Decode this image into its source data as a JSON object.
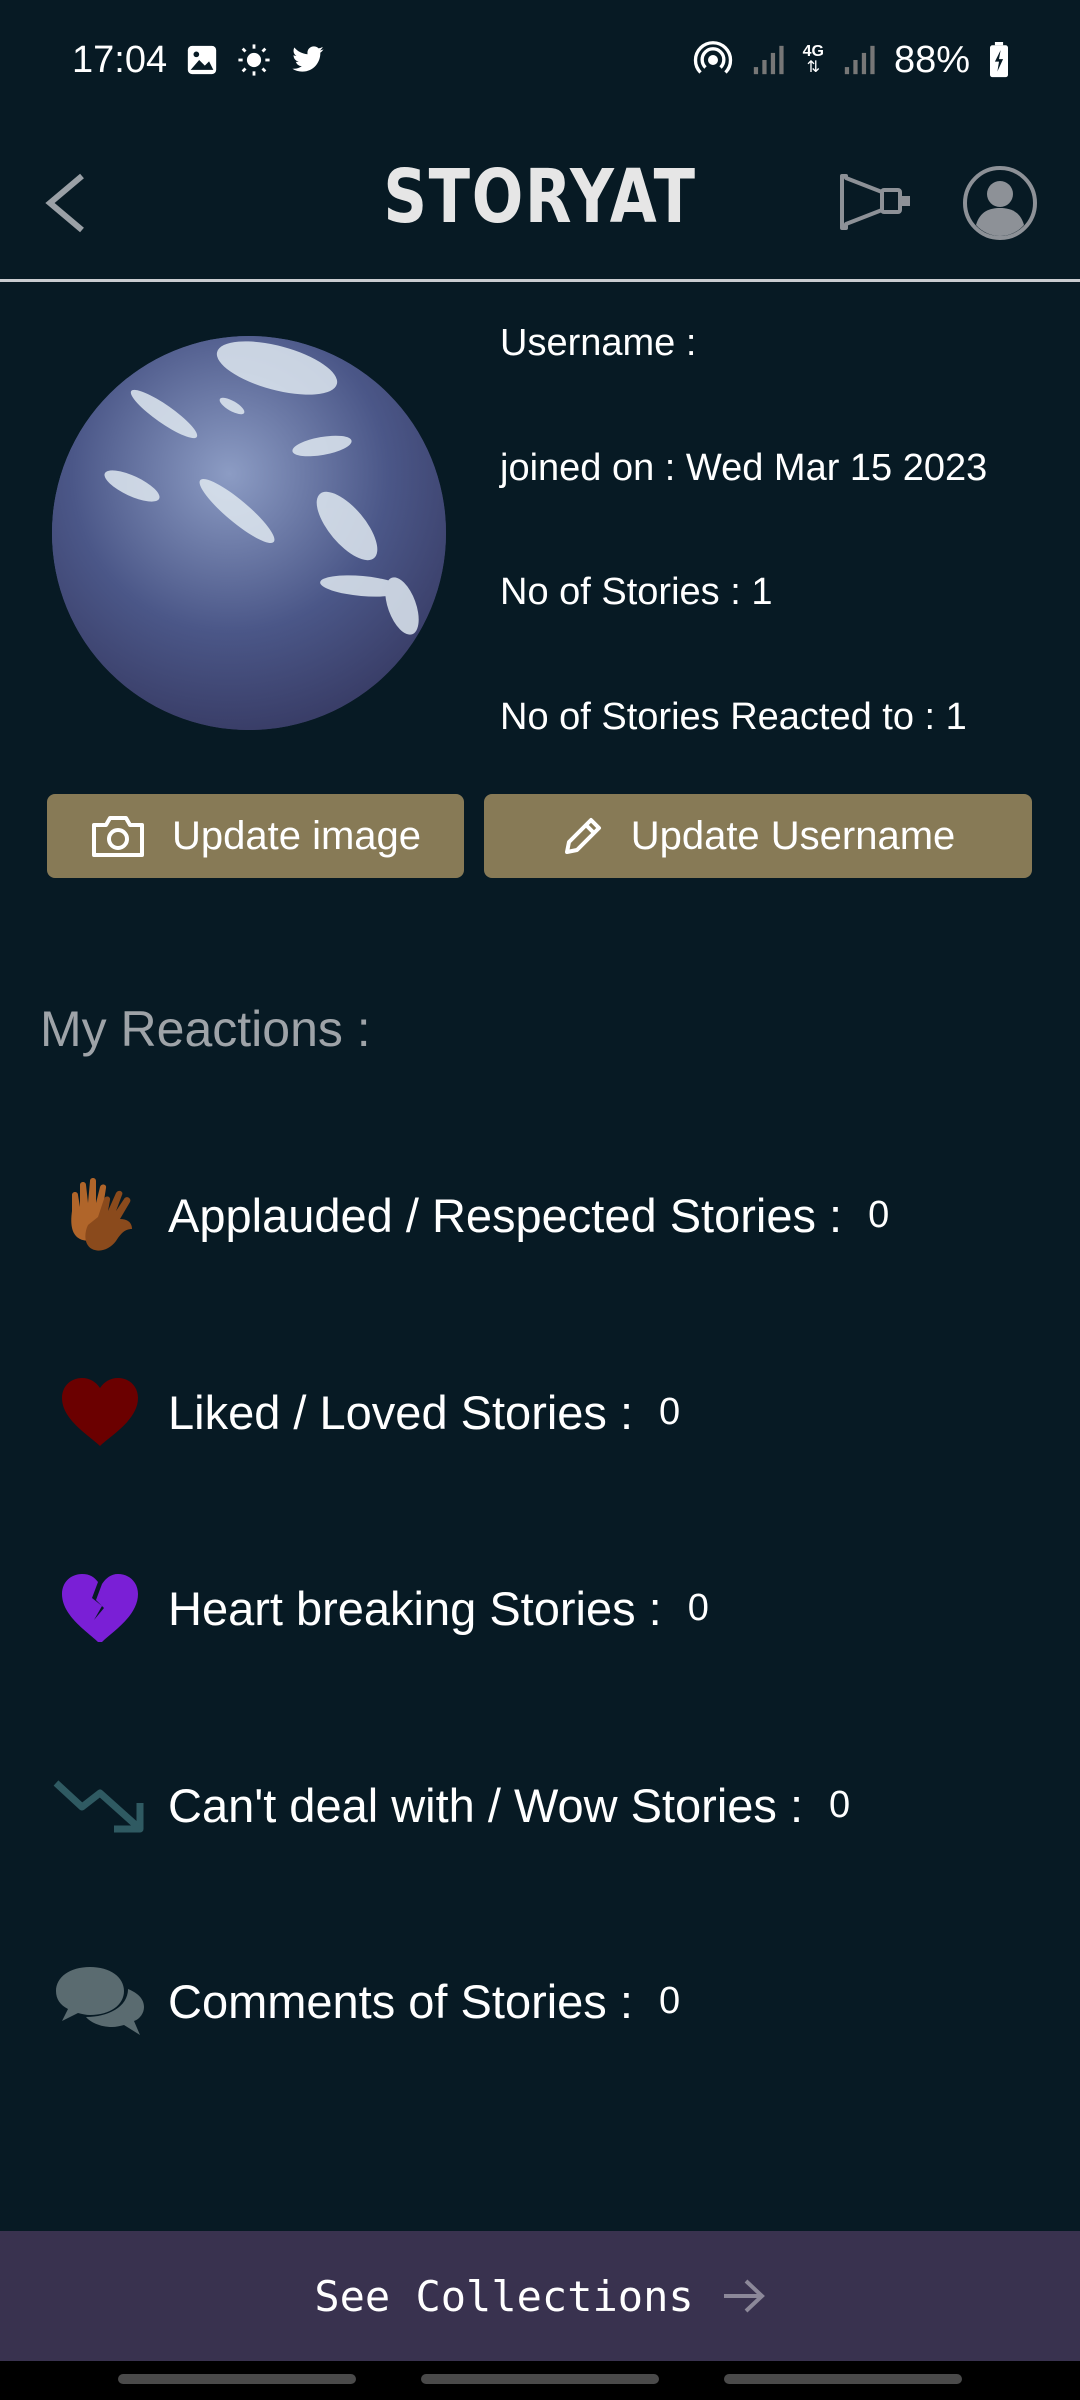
{
  "status_bar": {
    "time": "17:04",
    "battery": "88%",
    "network": "4G"
  },
  "header": {
    "title": "STORYAT"
  },
  "profile": {
    "username_label": "Username :",
    "joined": "joined on : Wed Mar 15 2023",
    "stories_count": "No of Stories : 1",
    "reacted_count": "No of Stories Reacted to : 1"
  },
  "buttons": {
    "update_image": "Update image",
    "update_username": "Update Username"
  },
  "reactions": {
    "title": "My Reactions :",
    "items": [
      {
        "label": "Applauded / Respected Stories :",
        "count": "0",
        "icon": "clapping-hands-icon"
      },
      {
        "label": "Liked / Loved Stories :",
        "count": "0",
        "icon": "heart-icon"
      },
      {
        "label": "Heart breaking Stories :",
        "count": "0",
        "icon": "broken-heart-icon"
      },
      {
        "label": "Can't deal with / Wow Stories :",
        "count": "0",
        "icon": "trending-down-icon"
      },
      {
        "label": "Comments of Stories :",
        "count": "0",
        "icon": "comments-icon"
      }
    ]
  },
  "footer": {
    "see_collections": "See Collections"
  },
  "colors": {
    "background": "#071a24",
    "button": "#877a56",
    "footer": "#39324f",
    "heart": "#6b0000",
    "broken_heart": "#7a1fd6",
    "clap": "#a05a22"
  }
}
